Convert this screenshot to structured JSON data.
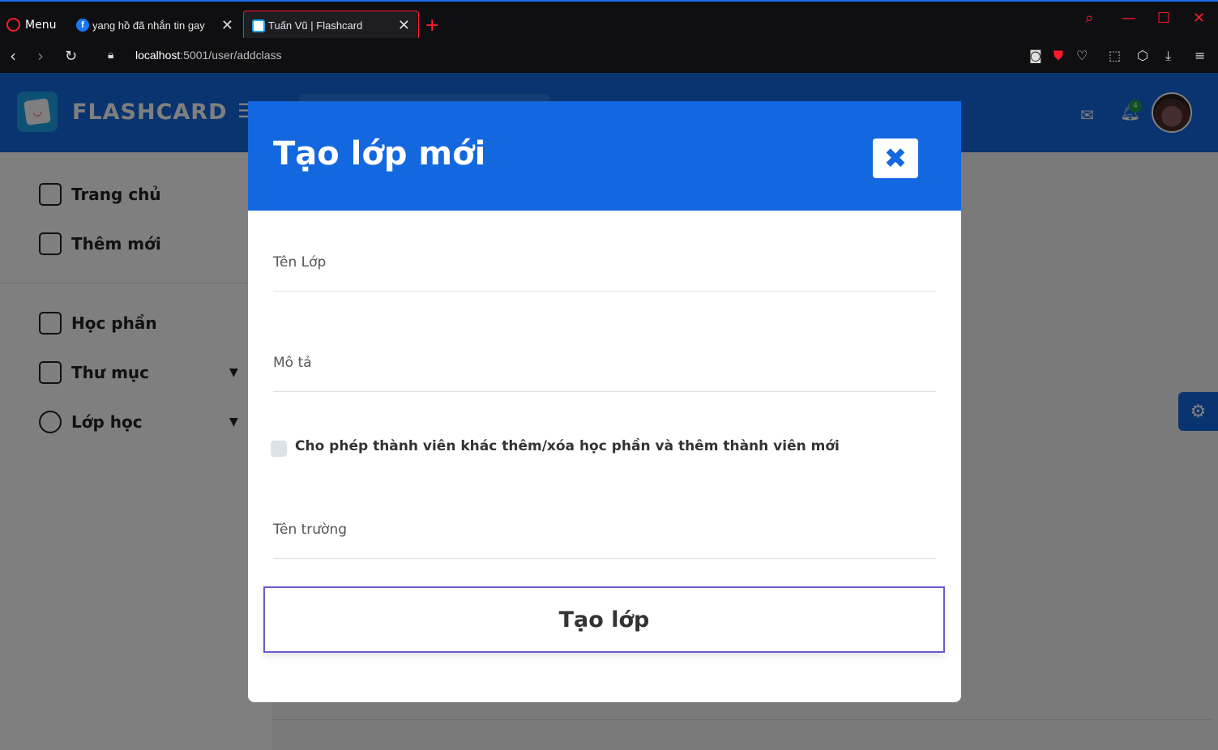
{
  "browser": {
    "menu_label": "Menu",
    "tabs": [
      {
        "title": "yang hồ đã nhắn tin gay"
      },
      {
        "title": "Tuấn Vũ | Flashcard"
      }
    ],
    "url_host": "localhost",
    "url_rest": ":5001/user/addclass"
  },
  "app": {
    "brand": "FLASHCARD",
    "notification_count": "4"
  },
  "sidebar": {
    "items": [
      {
        "label": "Trang chủ",
        "icon": "home-icon"
      },
      {
        "label": "Thêm mới",
        "icon": "edit-icon"
      },
      {
        "label": "Học phần",
        "icon": "copy-icon"
      },
      {
        "label": "Thư mục",
        "icon": "folder-icon"
      },
      {
        "label": "Lớp học",
        "icon": "user-icon"
      }
    ]
  },
  "modal": {
    "title": "Tạo lớp mới",
    "fields": {
      "class_name": "Tên Lớp",
      "description": "Mô tả",
      "school_name": "Tên trường"
    },
    "checkbox_label": "Cho phép thành viên khác thêm/xóa học phần và thêm thành viên mới",
    "submit_label": "Tạo lớp"
  },
  "colors": {
    "primary": "#1468df",
    "browser_accent": "#ff1b2d"
  }
}
